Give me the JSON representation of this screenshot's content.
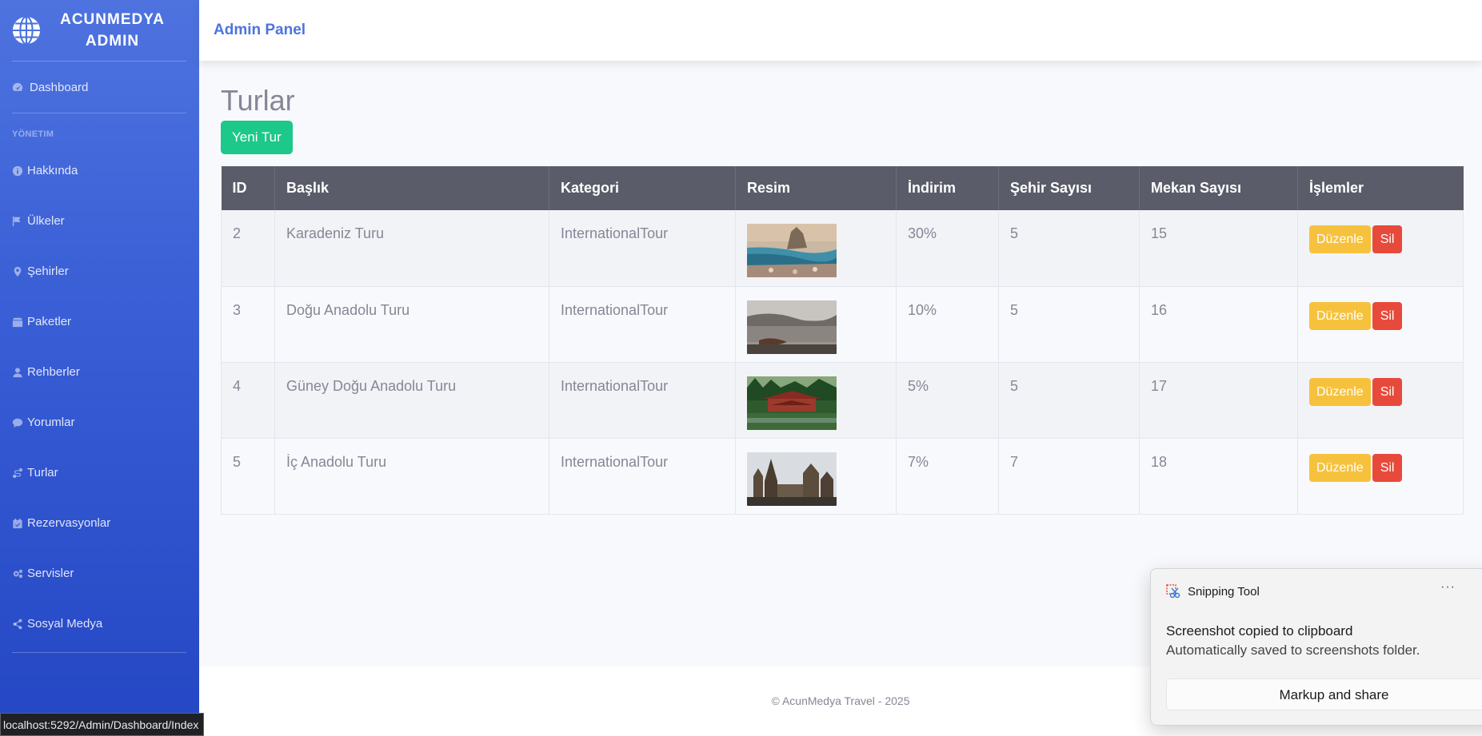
{
  "sidebar": {
    "brand_line1": "ACUNMEDYA",
    "brand_line2": "ADMIN",
    "dashboard_label": "Dashboard",
    "section_heading": "YÖNETIM",
    "items": [
      {
        "label": "Hakkında",
        "icon": "info-icon"
      },
      {
        "label": "Ülkeler",
        "icon": "flag-icon"
      },
      {
        "label": "Şehirler",
        "icon": "map-marker-icon"
      },
      {
        "label": "Paketler",
        "icon": "box-icon"
      },
      {
        "label": "Rehberler",
        "icon": "user-icon"
      },
      {
        "label": "Yorumlar",
        "icon": "comment-icon"
      },
      {
        "label": "Turlar",
        "icon": "route-icon"
      },
      {
        "label": "Rezervasyonlar",
        "icon": "calendar-check-icon"
      },
      {
        "label": "Servisler",
        "icon": "cogs-icon"
      },
      {
        "label": "Sosyal Medya",
        "icon": "share-icon"
      }
    ]
  },
  "topbar": {
    "title": "Admin Panel"
  },
  "page": {
    "title": "Turlar",
    "new_button": "Yeni Tur"
  },
  "table": {
    "headers": [
      "ID",
      "Başlık",
      "Kategori",
      "Resim",
      "İndirim",
      "Şehir Sayısı",
      "Mekan Sayısı",
      "İşlemler"
    ],
    "edit_label": "Düzenle",
    "delete_label": "Sil",
    "rows": [
      {
        "id": "2",
        "title": "Karadeniz Turu",
        "category": "InternationalTour",
        "discount": "30%",
        "city_count": "5",
        "place_count": "15"
      },
      {
        "id": "3",
        "title": "Doğu Anadolu Turu",
        "category": "InternationalTour",
        "discount": "10%",
        "city_count": "5",
        "place_count": "16"
      },
      {
        "id": "4",
        "title": "Güney Doğu Anadolu Turu",
        "category": "InternationalTour",
        "discount": "5%",
        "city_count": "5",
        "place_count": "17"
      },
      {
        "id": "5",
        "title": "İç Anadolu Turu",
        "category": "InternationalTour",
        "discount": "7%",
        "city_count": "7",
        "place_count": "18"
      }
    ]
  },
  "footer": {
    "text": "© AcunMedya Travel - 2025"
  },
  "statusbar": {
    "url": "localhost:5292/Admin/Dashboard/Index"
  },
  "toast": {
    "app_name": "Snipping Tool",
    "more": "···",
    "message": "Screenshot copied to clipboard",
    "sub_message": "Automatically saved to screenshots folder.",
    "button": "Markup and share"
  },
  "colors": {
    "primary": "#4e73df",
    "success": "#1cc88a",
    "warning": "#f6c23e",
    "danger": "#e74a3b",
    "table_head": "#5a5c69"
  }
}
